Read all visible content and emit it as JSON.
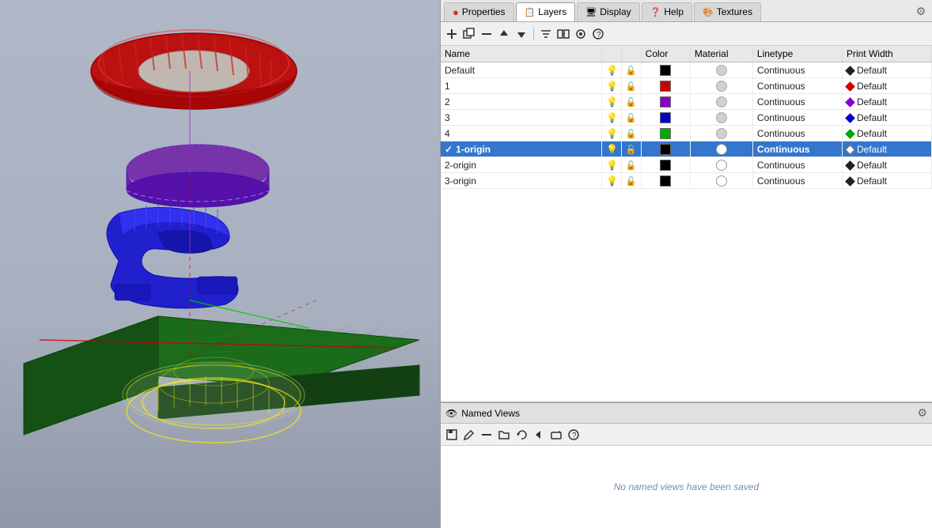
{
  "tabs": [
    {
      "id": "properties",
      "label": "Properties",
      "icon": "🔴",
      "active": false
    },
    {
      "id": "layers",
      "label": "Layers",
      "icon": "📋",
      "active": true
    },
    {
      "id": "display",
      "label": "Display",
      "icon": "🖥️",
      "active": false
    },
    {
      "id": "help",
      "label": "Help",
      "icon": "❓",
      "active": false
    },
    {
      "id": "textures",
      "label": "Textures",
      "icon": "🎨",
      "active": false
    }
  ],
  "toolbar_buttons": [
    "new",
    "duplicate",
    "delete",
    "moveup",
    "movedown",
    "filter",
    "merge",
    "properties",
    "help"
  ],
  "table_headers": {
    "name": "Name",
    "color": "Color",
    "material": "Material",
    "linetype": "Linetype",
    "printwidth": "Print Width"
  },
  "layers": [
    {
      "name": "Default",
      "on": true,
      "frozen": false,
      "locked": false,
      "color": "#000000",
      "material": "gray",
      "linetype": "Continuous",
      "printwidth": "Default",
      "selected": false,
      "diamond_color": "black"
    },
    {
      "name": "1",
      "on": true,
      "frozen": false,
      "locked": false,
      "color": "#cc0000",
      "material": "gray",
      "linetype": "Continuous",
      "printwidth": "Default",
      "selected": false,
      "diamond_color": "red"
    },
    {
      "name": "2",
      "on": true,
      "frozen": false,
      "locked": false,
      "color": "#8800cc",
      "material": "gray",
      "linetype": "Continuous",
      "printwidth": "Default",
      "selected": false,
      "diamond_color": "purple"
    },
    {
      "name": "3",
      "on": true,
      "frozen": false,
      "locked": false,
      "color": "#0000cc",
      "material": "gray",
      "linetype": "Continuous",
      "printwidth": "Default",
      "selected": false,
      "diamond_color": "blue"
    },
    {
      "name": "4",
      "on": true,
      "frozen": false,
      "locked": false,
      "color": "#00aa00",
      "material": "gray",
      "linetype": "Continuous",
      "printwidth": "Default",
      "selected": false,
      "diamond_color": "green"
    },
    {
      "name": "1-origin",
      "on": true,
      "frozen": false,
      "locked": false,
      "color": "#000000",
      "material": "white_circle",
      "linetype": "Continuous",
      "printwidth": "Default",
      "selected": true,
      "current": true,
      "diamond_color": "white"
    },
    {
      "name": "2-origin",
      "on": true,
      "frozen": false,
      "locked": false,
      "color": "#000000",
      "material": "white_circle",
      "linetype": "Continuous",
      "printwidth": "Default",
      "selected": false,
      "diamond_color": "black"
    },
    {
      "name": "3-origin",
      "on": true,
      "frozen": false,
      "locked": false,
      "color": "#000000",
      "material": "white_circle",
      "linetype": "Continuous",
      "printwidth": "Default",
      "selected": false,
      "diamond_color": "black"
    }
  ],
  "named_views": {
    "title": "Named Views",
    "empty_text": "No named views have been saved"
  },
  "colors": {
    "accent": "#3376cd",
    "bg_header": "#e8e8e8",
    "selected_row": "#3376cd"
  }
}
